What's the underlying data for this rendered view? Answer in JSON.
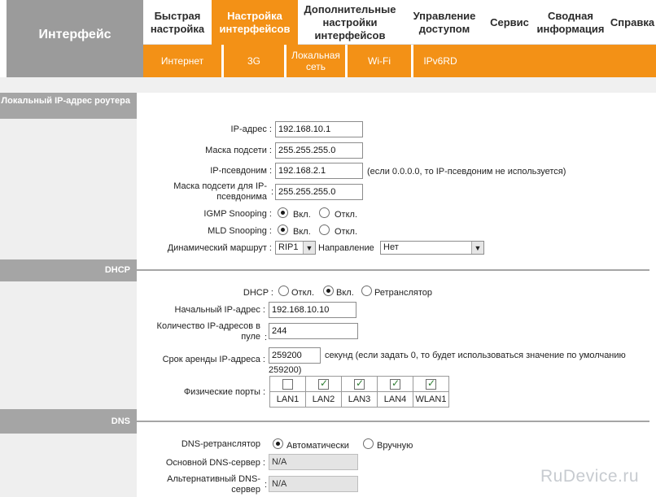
{
  "header": {
    "title": "Интерфейс",
    "nav": [
      {
        "label": "Быстрая\nнастройка"
      },
      {
        "label": "Настройка\nинтерфейсов"
      },
      {
        "label": "Дополнительные\nнастройки\nинтерфейсов"
      },
      {
        "label": "Управление\nдоступом"
      },
      {
        "label": "Сервис"
      },
      {
        "label": "Сводная\nинформация"
      },
      {
        "label": "Справка"
      }
    ],
    "subnav": [
      {
        "label": "Интернет"
      },
      {
        "label": "3G"
      },
      {
        "label": "Локальная\nсеть"
      },
      {
        "label": "Wi-Fi"
      },
      {
        "label": "IPv6RD"
      }
    ]
  },
  "lan": {
    "section_title": "Локальный IP-адрес роутера",
    "ip_label": "IP-адрес :",
    "ip_value": "192.168.10.1",
    "mask_label": "Маска подсети :",
    "mask_value": "255.255.255.0",
    "alias_label": "IP-псевдоним :",
    "alias_value": "192.168.2.1",
    "alias_hint": "(если 0.0.0.0, то IP-псевдоним не используется)",
    "alias_mask_label": "Маска подсети для IP-псевдонима",
    "alias_mask_colon": ":",
    "alias_mask_value": "255.255.255.0",
    "igmp_label": "IGMP Snooping :",
    "mld_label": "MLD Snooping :",
    "on_label": "Вкл.",
    "off_label": "Откл.",
    "route_label": "Динамический маршрут :",
    "route_value": "RIP1",
    "direction_label": "Направление",
    "direction_value": "Нет"
  },
  "dhcp": {
    "section_title": "DHCP",
    "mode_label": "DHCP :",
    "opt_off": "Откл.",
    "opt_on": "Вкл.",
    "opt_relay": "Ретранслятор",
    "start_label": "Начальный IP-адрес :",
    "start_value": "192.168.10.10",
    "pool_label": "Количество IP-адресов в пуле",
    "pool_colon": ":",
    "pool_value": "244",
    "lease_label": "Срок аренды IP-адреса :",
    "lease_value": "259200",
    "lease_hint": "секунд (если задать 0, то будет использоваться значение по умолчанию",
    "lease_hint2": "259200)",
    "ports_label": "Физические порты :",
    "ports": [
      {
        "name": "LAN1",
        "checked": false
      },
      {
        "name": "LAN2",
        "checked": true
      },
      {
        "name": "LAN3",
        "checked": true
      },
      {
        "name": "LAN4",
        "checked": true
      },
      {
        "name": "WLAN1",
        "checked": true
      }
    ]
  },
  "dns": {
    "section_title": "DNS",
    "relay_label": "DNS-ретранслятор",
    "auto_label": "Автоматически",
    "manual_label": "Вручную",
    "primary_label": "Основной DNS-сервер :",
    "primary_value": "N/A",
    "secondary_label": "Альтернативный DNS-сервер",
    "secondary_colon": ":",
    "secondary_value": "N/A"
  },
  "watermark": "RuDevice.ru",
  "colors": {
    "accent": "#f39116",
    "section_gray": "#a5a5a5",
    "side_gray": "#efefef"
  }
}
